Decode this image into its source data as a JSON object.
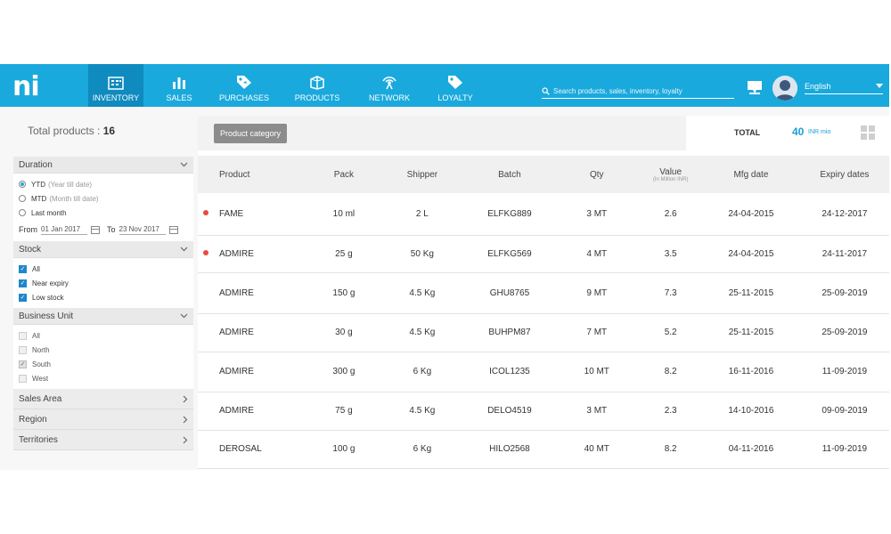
{
  "brand": {
    "logo_text": "ni",
    "accent": "#1aa9dd",
    "active_nav": "#0f8bbf"
  },
  "nav": {
    "items": [
      {
        "label": "INVENTORY",
        "icon": "building-icon",
        "active": true
      },
      {
        "label": "SALES",
        "icon": "bar-chart-icon",
        "active": false
      },
      {
        "label": "PURCHASES",
        "icon": "tag-icon",
        "active": false
      },
      {
        "label": "PRODUCTS",
        "icon": "box-icon",
        "active": false
      },
      {
        "label": "NETWORK",
        "icon": "antenna-icon",
        "active": false
      },
      {
        "label": "LOYALTY",
        "icon": "tag-filled-icon",
        "active": false
      }
    ]
  },
  "search": {
    "placeholder": "Search products, sales, inventory, loyalty"
  },
  "language": {
    "selected": "English"
  },
  "summary": {
    "total_products_label": "Total products : ",
    "total_products_value": "16",
    "category_button": "Product category",
    "total_label": "TOTAL",
    "total_value": "40",
    "total_unit": "INR mio"
  },
  "filters": {
    "duration": {
      "title": "Duration",
      "options": [
        {
          "label": "YTD",
          "sub": "(Year till date)",
          "selected": true
        },
        {
          "label": "MTD",
          "sub": "(Month till date)",
          "selected": false
        },
        {
          "label": "Last month",
          "sub": "",
          "selected": false
        }
      ],
      "from_label": "From",
      "from_value": "01 Jan 2017",
      "to_label": "To",
      "to_value": "23 Nov 2017"
    },
    "stock": {
      "title": "Stock",
      "options": [
        {
          "label": "All",
          "checked": true
        },
        {
          "label": "Near expiry",
          "checked": true
        },
        {
          "label": "Low stock",
          "checked": true
        }
      ]
    },
    "business_unit": {
      "title": "Business Unit",
      "options": [
        {
          "label": "All",
          "checked": false
        },
        {
          "label": "North",
          "checked": false
        },
        {
          "label": "South",
          "checked": true
        },
        {
          "label": "West",
          "checked": false
        }
      ]
    },
    "collapsed": [
      "Sales Area",
      "Region",
      "Territories"
    ]
  },
  "table": {
    "columns": [
      "Product",
      "Pack",
      "Shipper",
      "Batch",
      "Qty",
      "Value",
      "Mfg date",
      "Expiry dates"
    ],
    "value_sub": "(In Million INR)",
    "rows": [
      {
        "flag": true,
        "cells": [
          "FAME",
          "10 ml",
          "2 L",
          "ELFKG889",
          "3 MT",
          "2.6",
          "24-04-2015",
          "24-12-2017"
        ]
      },
      {
        "flag": true,
        "cells": [
          "ADMIRE",
          "25 g",
          "50 Kg",
          "ELFKG569",
          "4 MT",
          "3.5",
          "24-04-2015",
          "24-11-2017"
        ]
      },
      {
        "flag": false,
        "cells": [
          "ADMIRE",
          "150 g",
          "4.5 Kg",
          "GHU8765",
          "9 MT",
          "7.3",
          "25-11-2015",
          "25-09-2019"
        ]
      },
      {
        "flag": false,
        "cells": [
          "ADMIRE",
          "30 g",
          "4.5 Kg",
          "BUHPM87",
          "7 MT",
          "5.2",
          "25-11-2015",
          "25-09-2019"
        ]
      },
      {
        "flag": false,
        "cells": [
          "ADMIRE",
          "300 g",
          "6 Kg",
          "ICOL1235",
          "10 MT",
          "8.2",
          "16-11-2016",
          "11-09-2019"
        ]
      },
      {
        "flag": false,
        "cells": [
          "ADMIRE",
          "75 g",
          "4.5 Kg",
          "DELO4519",
          "3 MT",
          "2.3",
          "14-10-2016",
          "09-09-2019"
        ]
      },
      {
        "flag": false,
        "cells": [
          "DEROSAL",
          "100 g",
          "6 Kg",
          "HILO2568",
          "40 MT",
          "8.2",
          "04-11-2016",
          "11-09-2019"
        ]
      }
    ]
  }
}
